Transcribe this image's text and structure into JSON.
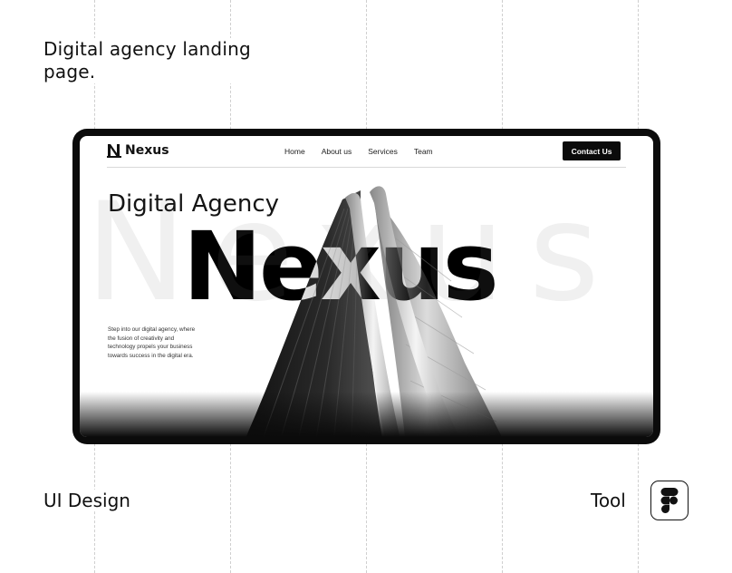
{
  "page": {
    "heading": "Digital agency landing page.",
    "category": "UI Design",
    "tool_label": "Tool",
    "tool_icon": "figma-icon"
  },
  "site": {
    "brand": "Nexus",
    "nav": [
      "Home",
      "About us",
      "Services",
      "Team"
    ],
    "cta": "Contact Us",
    "hero": {
      "subtitle": "Digital Agency",
      "title": "Nexus",
      "background_word": "Nexus",
      "description": "Step into our digital agency, where the fusion of creativity and technology propels your business towards success in the digital era."
    }
  },
  "colors": {
    "frame": "#0b0b0b",
    "background": "#ffffff",
    "text": "#111111"
  }
}
